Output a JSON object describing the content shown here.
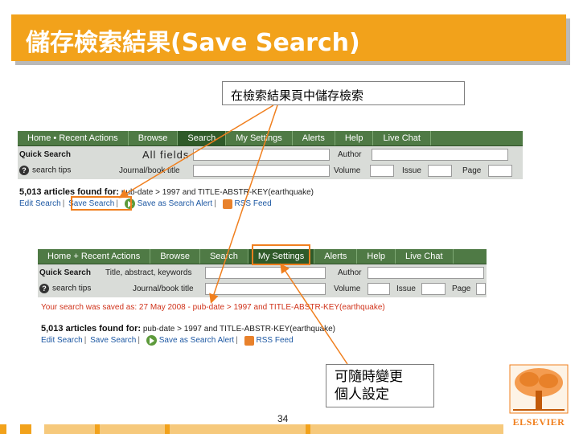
{
  "slide": {
    "title": "儲存檢索結果(Save Search)",
    "callout_top": "在檢索結果頁中儲存檢索",
    "callout_bottom_line1": "可隨時變更",
    "callout_bottom_line2": "個人設定",
    "page_number": "34",
    "logo_text": "ELSEVIER",
    "accent_color": "#f2a21b",
    "highlight_color": "#f07f1e"
  },
  "screenshot1": {
    "nav": [
      "Home",
      "Recent Actions",
      "Browse",
      "Search",
      "My Settings",
      "Alerts",
      "Help",
      "Live Chat"
    ],
    "quick_search": "Quick Search",
    "all_fields": "All fields",
    "author": "Author",
    "search_tips": "search tips",
    "journal": "Journal/book title",
    "volume": "Volume",
    "issue": "Issue",
    "page": "Page",
    "found": "5,013 articles found for:",
    "query": "pub-date > 1997 and TITLE-ABSTR-KEY(earthquake)",
    "edit_search": "Edit Search",
    "save_search": "Save Search",
    "save_alert": "Save as Search Alert",
    "rss": "RSS Feed"
  },
  "screenshot2": {
    "nav": [
      "Home",
      "Recent Actions",
      "Browse",
      "Search",
      "My Settings",
      "Alerts",
      "Help",
      "Live Chat"
    ],
    "quick_search": "Quick Search",
    "title_field": "Title, abstract, keywords",
    "author": "Author",
    "search_tips": "search tips",
    "journal": "Journal/book title",
    "volume": "Volume",
    "issue": "Issue",
    "page": "Page",
    "saved_msg": "Your search was saved as: 27 May 2008 - pub-date > 1997 and TITLE-ABSTR-KEY(earthquake)",
    "found": "5,013 articles found for:",
    "query": "pub-date > 1997 and TITLE-ABSTR-KEY(earthquake)",
    "edit_search": "Edit Search",
    "save_search": "Save Search",
    "save_alert": "Save as Search Alert",
    "rss": "RSS Feed"
  }
}
